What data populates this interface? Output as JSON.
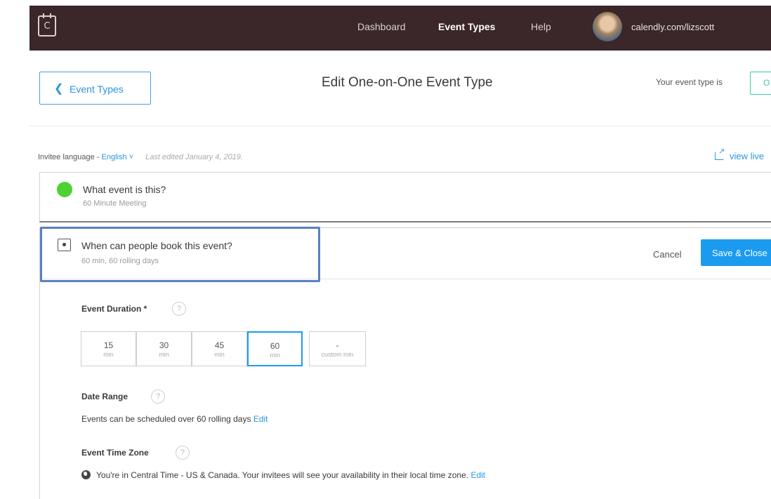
{
  "topbar": {
    "logo_letter": "C",
    "nav": [
      "Dashboard",
      "Event Types",
      "Help"
    ],
    "active_nav": "Event Types",
    "user_url": "calendly.com/lizscott"
  },
  "header": {
    "back_label": "Event Types",
    "title": "Edit One-on-One Event Type",
    "status_label": "Your event type is",
    "status_value": "O"
  },
  "meta": {
    "language_prefix": "Invitee language - ",
    "language": "English",
    "last_edited": "Last edited January 4, 2019.",
    "view_live": "view live"
  },
  "section_what": {
    "title": "What event is this?",
    "subtitle": "60 Minute Meeting"
  },
  "section_when": {
    "title": "When can people book this event?",
    "subtitle": "60 min, 60 rolling days",
    "cancel_label": "Cancel",
    "save_label": "Save & Close"
  },
  "duration": {
    "label": "Event Duration *",
    "help": "?",
    "options": [
      {
        "value": "15",
        "unit": "min"
      },
      {
        "value": "30",
        "unit": "min"
      },
      {
        "value": "45",
        "unit": "min"
      },
      {
        "value": "60",
        "unit": "min"
      },
      {
        "value": "-",
        "unit": "custom min"
      }
    ],
    "selected": "60"
  },
  "date_range": {
    "label": "Date Range",
    "help": "?",
    "text": "Events can be scheduled over 60 rolling days",
    "edit": "Edit"
  },
  "time_zone": {
    "label": "Event Time Zone",
    "help": "?",
    "text": "You're in Central Time - US & Canada. Your invitees will see your availability in their local time zone.",
    "edit": "Edit"
  },
  "colors": {
    "topbar_bg": "#3b2629",
    "accent": "#1a9bef",
    "status_green": "#4cd233",
    "highlight": "#5b7fc2"
  }
}
